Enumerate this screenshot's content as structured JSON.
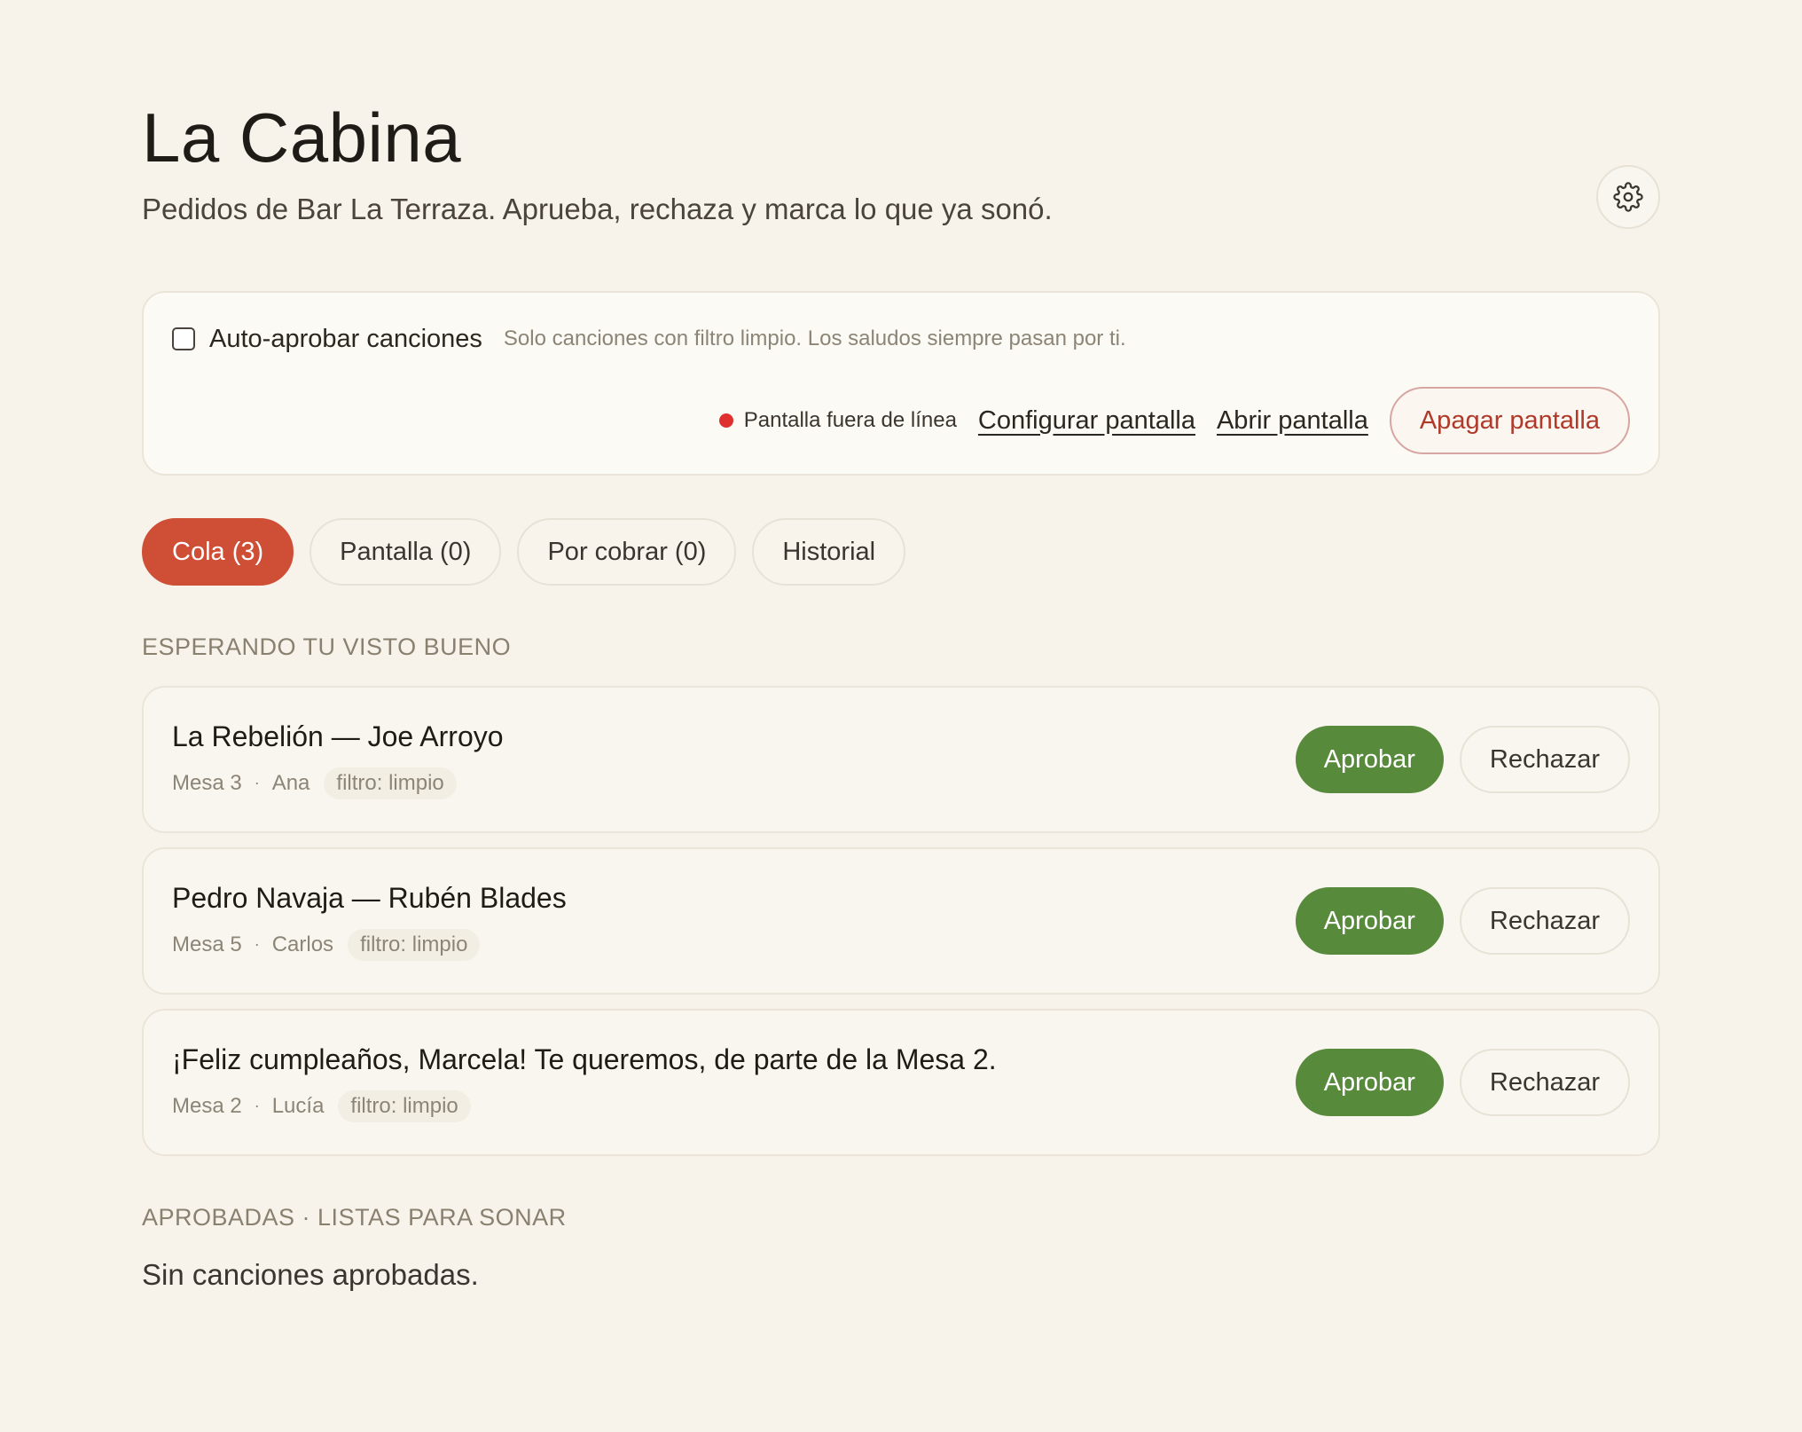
{
  "header": {
    "title": "La Cabina",
    "subtitle": "Pedidos de Bar La Terraza. Aprueba, rechaza y marca lo que ya sonó.",
    "settings_icon": "gear-icon"
  },
  "controls": {
    "auto_approve_label": "Auto-aprobar canciones",
    "auto_approve_checked": false,
    "auto_approve_hint": "Solo canciones con filtro limpio. Los saludos siempre pasan por ti.",
    "screen_status": "Pantalla fuera de línea",
    "screen_status_color": "#e02f2f",
    "configure_link": "Configurar pantalla",
    "open_link": "Abrir pantalla",
    "turn_off_button": "Apagar pantalla"
  },
  "tabs": [
    {
      "label": "Cola (3)",
      "active": true
    },
    {
      "label": "Pantalla (0)",
      "active": false
    },
    {
      "label": "Por cobrar (0)",
      "active": false
    },
    {
      "label": "Historial",
      "active": false
    }
  ],
  "pending": {
    "heading": "ESPERANDO TU VISTO BUENO",
    "items": [
      {
        "title": "La Rebelión — Joe Arroyo",
        "table": "Mesa 3",
        "sep": "·",
        "person": "Ana",
        "filter": "filtro: limpio",
        "approve": "Aprobar",
        "reject": "Rechazar"
      },
      {
        "title": "Pedro Navaja — Rubén Blades",
        "table": "Mesa 5",
        "sep": "·",
        "person": "Carlos",
        "filter": "filtro: limpio",
        "approve": "Aprobar",
        "reject": "Rechazar"
      },
      {
        "title": "¡Feliz cumpleaños, Marcela! Te queremos, de parte de la Mesa 2.",
        "table": "Mesa 2",
        "sep": "·",
        "person": "Lucía",
        "filter": "filtro: limpio",
        "approve": "Aprobar",
        "reject": "Rechazar"
      }
    ]
  },
  "approved": {
    "heading": "APROBADAS · LISTAS PARA SONAR",
    "empty_text": "Sin canciones aprobadas."
  },
  "colors": {
    "background": "#f7f3eb",
    "accent": "#cf4e36",
    "approve": "#588a3c",
    "danger_text": "#b03a2a"
  }
}
